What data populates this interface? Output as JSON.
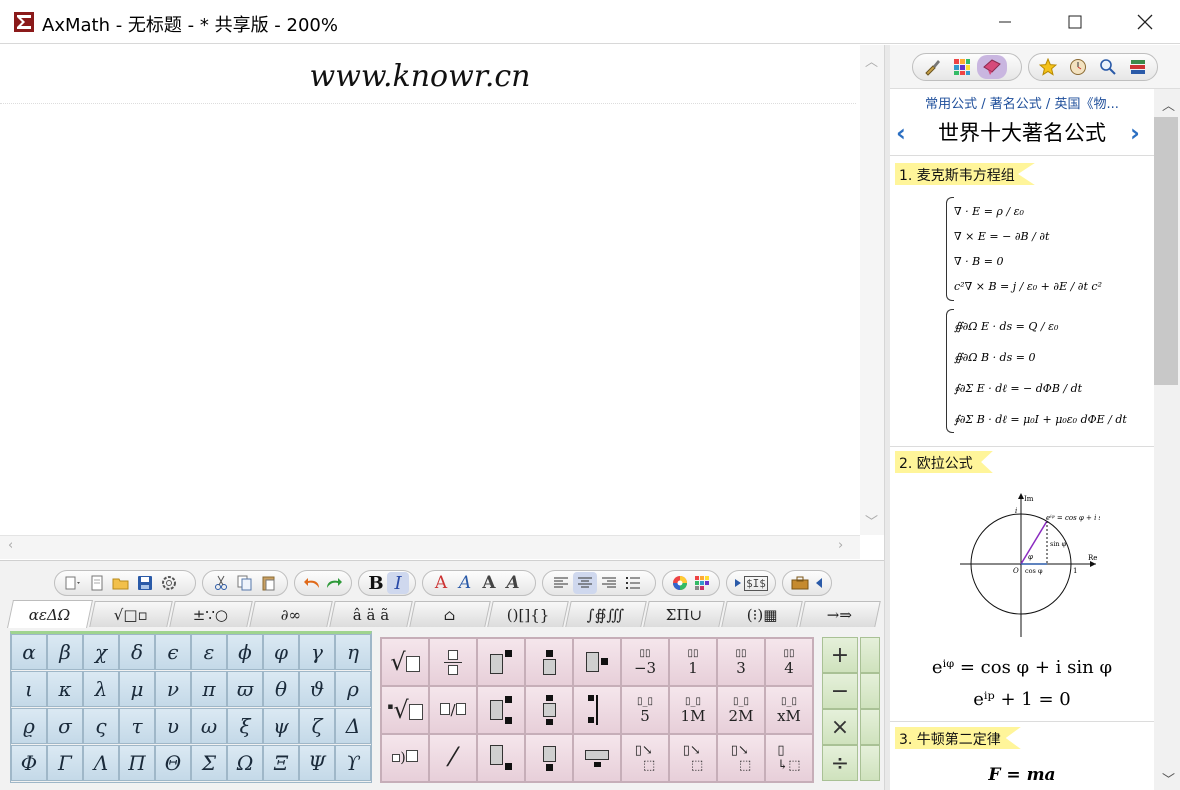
{
  "app": {
    "title": "AxMath - 无标题 - * 共享版 - 200%",
    "minimize_icon": "minimize-icon",
    "maximize_icon": "maximize-icon",
    "close_icon": "close-icon"
  },
  "editor": {
    "content": "www.knowr.cn"
  },
  "toolbar_groups": [
    {
      "name": "file",
      "icons": [
        "new-menu-icon",
        "new-document-icon",
        "open-folder-icon",
        "save-icon",
        "settings-icon"
      ]
    },
    {
      "name": "clipboard",
      "icons": [
        "cut-icon",
        "copy-icon",
        "paste-icon"
      ]
    },
    {
      "name": "history",
      "icons": [
        "undo-icon",
        "redo-icon"
      ]
    },
    {
      "name": "style",
      "bold": "B",
      "italic": "I"
    },
    {
      "name": "font",
      "labels": [
        "A",
        "A",
        "A",
        "A"
      ]
    },
    {
      "name": "align",
      "icons": [
        "align-left-icon",
        "align-center-icon",
        "align-right-icon",
        "align-distribute-icon"
      ]
    },
    {
      "name": "color",
      "icons": [
        "color-wheel-icon",
        "color-grid-icon"
      ]
    },
    {
      "name": "export",
      "label": "$I$"
    },
    {
      "name": "tools",
      "icons": [
        "toolbox-icon",
        "speaker-icon"
      ]
    }
  ],
  "symbol_tabs": [
    "αεΔΩ",
    "√□▫",
    "±∵○",
    "∂∞",
    "â ä ã",
    "⌂",
    "()[]{}",
    "∫∯∭",
    "ΣΠ∪",
    "(⁝)▦",
    "→⇒"
  ],
  "greek": [
    [
      "α",
      "β",
      "χ",
      "δ",
      "ϵ",
      "ε",
      "ϕ",
      "φ",
      "γ",
      "η"
    ],
    [
      "ι",
      "κ",
      "λ",
      "μ",
      "ν",
      "π",
      "ϖ",
      "θ",
      "ϑ",
      "ρ"
    ],
    [
      "ϱ",
      "σ",
      "ς",
      "τ",
      "υ",
      "ω",
      "ξ",
      "ψ",
      "ζ",
      "Δ"
    ],
    [
      "Φ",
      "Γ",
      "Λ",
      "Π",
      "Θ",
      "Σ",
      "Ω",
      "Ξ",
      "Ψ",
      "ϒ"
    ]
  ],
  "template_labels": {
    "r1c6": "−3",
    "r1c7": "1",
    "r1c8": "3",
    "r1c9": "4",
    "r2c6": "5",
    "r2c7": "1M",
    "r2c8": "2M",
    "r2c9": "xM"
  },
  "operators": [
    "+",
    "−",
    "×",
    "÷"
  ],
  "right_panel": {
    "tab_icons": [
      "brush-icon",
      "grid-icon",
      "bookmark-icon",
      "star-icon",
      "clock-icon",
      "search-icon",
      "books-icon"
    ],
    "breadcrumb": "常用公式 / 著名公式 / 英国《物...",
    "heading": "世界十大著名公式",
    "prev_icon": "chevron-left-icon",
    "next_icon": "chevron-right-icon",
    "sections": [
      {
        "title": "1. 麦克斯韦方程组"
      },
      {
        "title": "2. 欧拉公式"
      },
      {
        "title": "3. 牛顿第二定律"
      }
    ],
    "maxwell_diff": [
      "∇ · E = ρ / ε₀",
      "∇ × E = − ∂B / ∂t",
      "∇ · B = 0",
      "c²∇ × B = j / ε₀ + ∂E / ∂t c²"
    ],
    "maxwell_int": [
      "∯∂Ω E · ds = Q / ε₀",
      "∯∂Ω B · ds = 0",
      "∮∂Σ E · dℓ = − dΦB / dt",
      "∮∂Σ B · dℓ = μ₀I + μ₀ε₀ dΦE / dt"
    ],
    "euler_plot": {
      "axis_im": "Im",
      "axis_re": "Re",
      "origin": "O",
      "one_x": "1",
      "one_y": "i",
      "point_label": "eⁱᵠ = cos φ + i sin φ",
      "sin_label": "sin φ",
      "cos_label": "cos φ",
      "angle_label": "φ"
    },
    "euler_formula_1": "eⁱᵠ = cos φ + i sin φ",
    "euler_formula_2": "eⁱᵖ + 1 = 0",
    "newton_formula": "F = ma"
  }
}
